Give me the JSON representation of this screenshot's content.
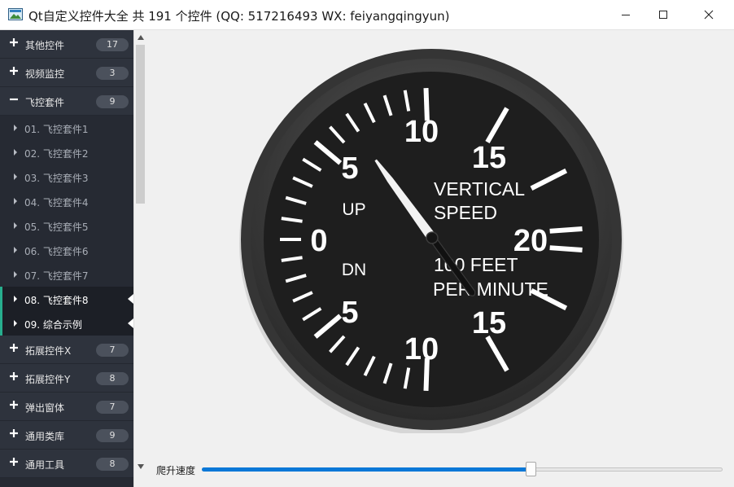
{
  "window": {
    "title": "Qt自定义控件大全 共 191 个控件 (QQ: 517216493 WX: feiyangqingyun)"
  },
  "sidebar": {
    "groups_top": [
      {
        "label": "其他控件",
        "count": "17",
        "expanded": false
      },
      {
        "label": "视频监控",
        "count": "3",
        "expanded": false
      },
      {
        "label": "飞控套件",
        "count": "9",
        "expanded": true
      }
    ],
    "children": [
      {
        "label": "01. 飞控套件1",
        "active": false
      },
      {
        "label": "02. 飞控套件2",
        "active": false
      },
      {
        "label": "03. 飞控套件3",
        "active": false
      },
      {
        "label": "04. 飞控套件4",
        "active": false
      },
      {
        "label": "05. 飞控套件5",
        "active": false
      },
      {
        "label": "06. 飞控套件6",
        "active": false
      },
      {
        "label": "07. 飞控套件7",
        "active": false
      },
      {
        "label": "08. 飞控套件8",
        "active": true
      },
      {
        "label": "09. 综合示例",
        "active": true
      }
    ],
    "groups_bottom": [
      {
        "label": "拓展控件X",
        "count": "7",
        "expanded": false
      },
      {
        "label": "拓展控件Y",
        "count": "8",
        "expanded": false
      },
      {
        "label": "弹出窗体",
        "count": "7",
        "expanded": false
      },
      {
        "label": "通用类库",
        "count": "9",
        "expanded": false
      },
      {
        "label": "通用工具",
        "count": "8",
        "expanded": false
      }
    ]
  },
  "gauge": {
    "scale_labels": {
      "up": [
        "5",
        "10",
        "15",
        "20"
      ],
      "zero": "0",
      "down": [
        "5",
        "10",
        "15"
      ]
    },
    "title_line1": "VERTICAL",
    "title_line2": "SPEED",
    "up_label": "UP",
    "down_label": "DN",
    "unit_line1": "100 FEET",
    "unit_line2": "PER MINUTE",
    "needle_value": 6
  },
  "slider": {
    "label": "爬升速度",
    "value_fraction": 0.632
  },
  "colors": {
    "sidebar_bg": "#262a33",
    "active_indicator": "#27ae8e",
    "slider_fill": "#0a78d7",
    "gauge_face": "#1e1e1e"
  }
}
